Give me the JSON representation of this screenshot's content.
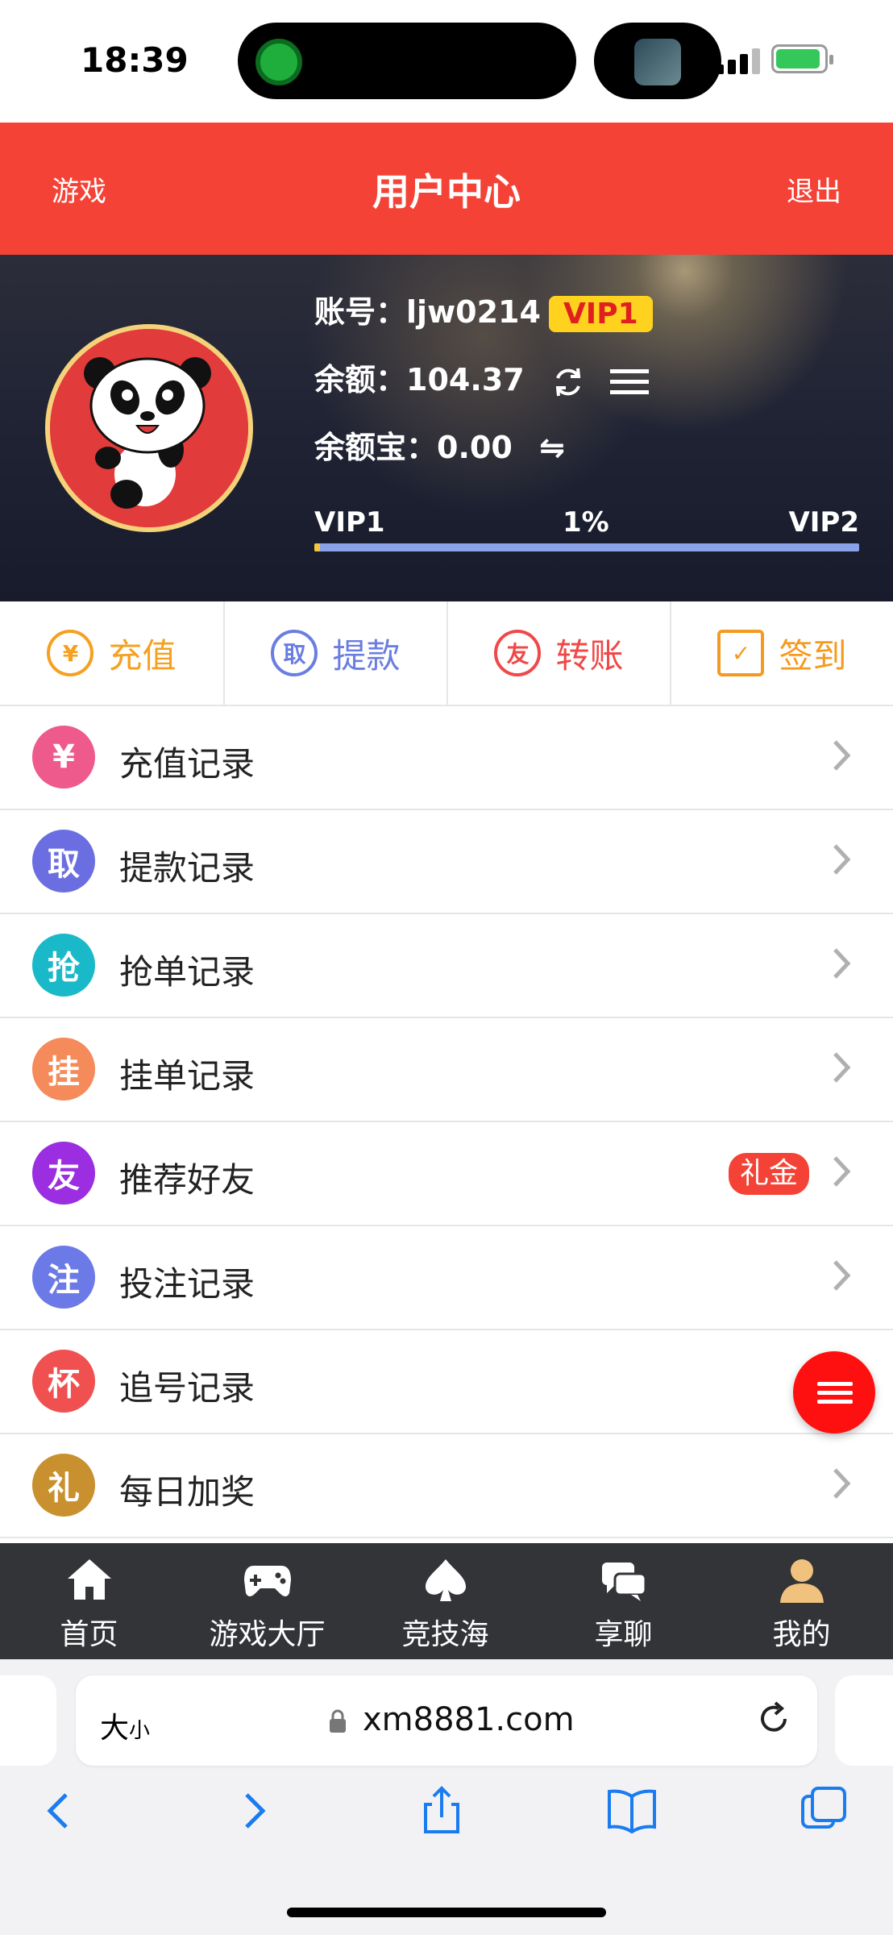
{
  "status_bar": {
    "time": "18:39"
  },
  "header": {
    "left": "游戏",
    "title": "用户中心",
    "right": "退出"
  },
  "profile": {
    "account_label": "账号：",
    "account": "ljw0214",
    "vip_badge": "VIP1",
    "balance_label": "余额：",
    "balance": "104.37",
    "yuebao_label": "余额宝：",
    "yuebao": "0.00",
    "transfer_glyph": "⇋",
    "progress": {
      "from": "VIP1",
      "percent_label": "1%",
      "to": "VIP2",
      "value": 0.01
    }
  },
  "actions": [
    {
      "label": "充值",
      "glyph": "¥",
      "color": "#f5a020"
    },
    {
      "label": "提款",
      "glyph": "取",
      "color": "#6a7de0"
    },
    {
      "label": "转账",
      "glyph": "友",
      "color": "#f04848"
    },
    {
      "label": "签到",
      "glyph": "✓",
      "color": "#f59a20"
    }
  ],
  "menu": [
    {
      "label": "充值记录",
      "glyph": "¥",
      "color": "#ee5a8c"
    },
    {
      "label": "提款记录",
      "glyph": "取",
      "color": "#6b6ee0"
    },
    {
      "label": "抢单记录",
      "glyph": "抢",
      "color": "#1ab9c9"
    },
    {
      "label": "挂单记录",
      "glyph": "挂",
      "color": "#f58a5a"
    },
    {
      "label": "推荐好友",
      "glyph": "友",
      "color": "#9b2ee0",
      "badge": "礼金"
    },
    {
      "label": "投注记录",
      "glyph": "注",
      "color": "#6b7ae6"
    },
    {
      "label": "追号记录",
      "glyph": "杯",
      "color": "#f05050"
    },
    {
      "label": "每日加奖",
      "glyph": "礼",
      "color": "#c8902e"
    }
  ],
  "tabbar": [
    {
      "label": "首页",
      "icon": "home-icon"
    },
    {
      "label": "游戏大厅",
      "icon": "gamepad-icon"
    },
    {
      "label": "竞技海",
      "icon": "spade-icon"
    },
    {
      "label": "享聊",
      "icon": "chat-icon"
    },
    {
      "label": "我的",
      "icon": "user-icon"
    }
  ],
  "browser": {
    "aa_big": "大",
    "aa_small": "小",
    "url": "xm8881.com"
  }
}
